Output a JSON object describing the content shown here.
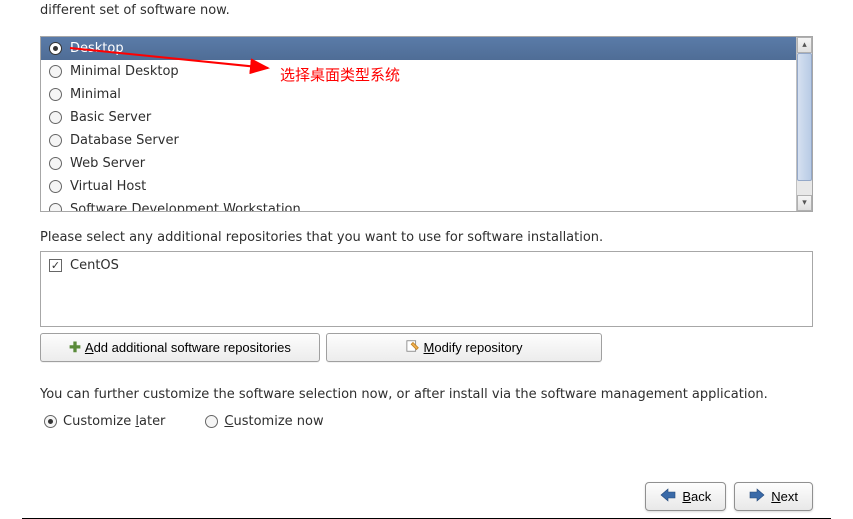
{
  "top_text": "different set of software now.",
  "install_types": [
    {
      "label": "Desktop",
      "selected": true
    },
    {
      "label": "Minimal Desktop",
      "selected": false
    },
    {
      "label": "Minimal",
      "selected": false
    },
    {
      "label": "Basic Server",
      "selected": false
    },
    {
      "label": "Database Server",
      "selected": false
    },
    {
      "label": "Web Server",
      "selected": false
    },
    {
      "label": "Virtual Host",
      "selected": false
    },
    {
      "label": "Software Development Workstation",
      "selected": false
    }
  ],
  "annotation_text": "选择桌面类型系统",
  "repositories_label": "Please select any additional repositories that you want to use for software installation.",
  "repositories": [
    {
      "label": "CentOS",
      "checked": true
    }
  ],
  "buttons": {
    "add_repo_prefix": "A",
    "add_repo_rest": "dd additional software repositories",
    "modify_repo_prefix": "M",
    "modify_repo_rest": "odify repository"
  },
  "customize_text": "You can further customize the software selection now, or after install via the software management application.",
  "customize_options": {
    "later_prefix": "Customize ",
    "later_u": "l",
    "later_rest": "ater",
    "now_prefix": "C",
    "now_rest": "ustomize now"
  },
  "nav": {
    "back_u": "B",
    "back_rest": "ack",
    "next_u": "N",
    "next_rest": "ext"
  }
}
